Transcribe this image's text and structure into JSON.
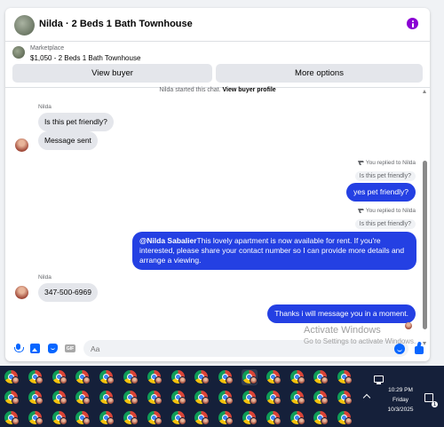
{
  "header": {
    "title": "Nilda · 2 Beds 1 Bath Townhouse"
  },
  "marketplace": {
    "label": "Marketplace",
    "item": "$1,050 - 2 Beds 1 Bath Townhouse"
  },
  "actions": {
    "view_buyer": "View buyer",
    "more_options": "More options"
  },
  "system": {
    "started": "Nilda started this chat. ",
    "profile_link": "View buyer profile"
  },
  "messages": {
    "sender1": "Nilda",
    "m1": "Is this pet friendly?",
    "m2": "Message sent",
    "reply1_note": "You replied to Nilda",
    "reply1_quote": "Is this pet friendly?",
    "reply1_text": "yes pet friendly?",
    "reply2_note": "You replied to Nilda",
    "reply2_quote": "Is this pet friendly?",
    "reply2_mention": "@Nilda Sabalier",
    "reply2_text": "This lovely apartment is now available for rent. If you're interested, please share your contact number so I can provide more details and arrange a viewing.",
    "sender2": "Nilda",
    "m3": "347-500-6969",
    "m4": "Thanks i will message you in a moment."
  },
  "composer": {
    "placeholder": "Aa",
    "gif_label": "GIF"
  },
  "watermark": {
    "line1": "Activate Windows",
    "line2": "Go to Settings to activate Windows."
  },
  "taskbar": {
    "time": "10:29 PM",
    "day": "Friday",
    "date": "10/3/2025",
    "notification_count": "1"
  },
  "colors": {
    "outgoing_bubble": "#2440e3",
    "incoming_bubble": "#e4e6eb",
    "accent": "#0866ff",
    "info": "#8a00d4",
    "taskbar": "#15203a"
  }
}
